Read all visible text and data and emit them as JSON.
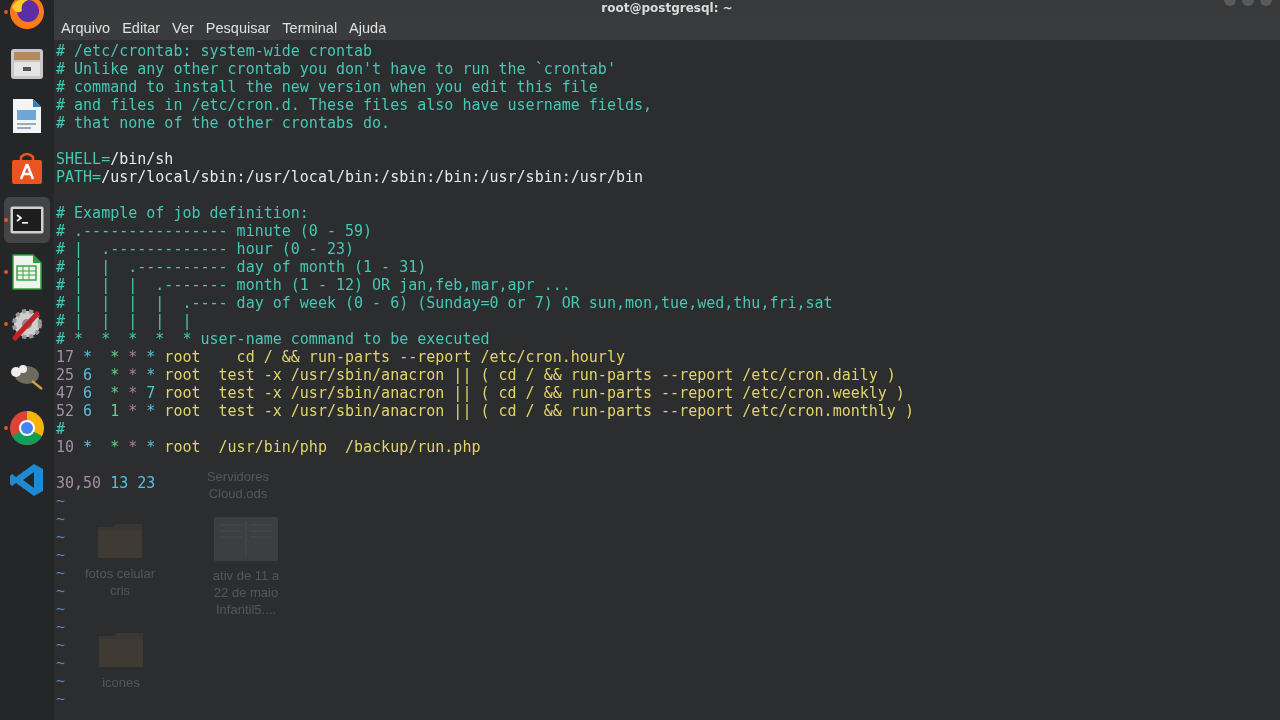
{
  "dock": {
    "items": [
      {
        "kind": "fox",
        "running": true,
        "selected": false
      },
      {
        "kind": "cabinet",
        "running": false,
        "selected": false
      },
      {
        "kind": "document",
        "running": false,
        "selected": false
      },
      {
        "kind": "bag",
        "running": false,
        "selected": false
      },
      {
        "kind": "terminal",
        "running": true,
        "selected": true
      },
      {
        "kind": "sheet",
        "running": true,
        "selected": false
      },
      {
        "kind": "wrench",
        "running": true,
        "selected": false
      },
      {
        "kind": "creature",
        "running": false,
        "selected": false
      },
      {
        "kind": "wheel",
        "running": true,
        "selected": false
      },
      {
        "kind": "ribbon",
        "running": false,
        "selected": false
      }
    ]
  },
  "window": {
    "title": "root@postgresql: ~"
  },
  "menu": [
    "Arquivo",
    "Editar",
    "Ver",
    "Pesquisar",
    "Terminal",
    "Ajuda"
  ],
  "desktop_icons": [
    {
      "label": "Servidores Cloud.ods"
    },
    {
      "label": "fotos celular cris",
      "kind": "folder"
    },
    {
      "label": "ativ de 11 a 22 de maio Infantil5....",
      "kind": "document"
    },
    {
      "label": "icones",
      "kind": "folder"
    }
  ],
  "terminal": {
    "lines": [
      {
        "kind": "code",
        "segments": [
          {
            "kind": "comment",
            "text": "# /etc/crontab: system-wide crontab"
          }
        ]
      },
      {
        "kind": "code",
        "segments": [
          {
            "kind": "comment",
            "text": "# Unlike any other crontab you don't have to run the `crontab'"
          }
        ]
      },
      {
        "kind": "code",
        "segments": [
          {
            "kind": "comment",
            "text": "# command to install the new version when you edit this file"
          }
        ]
      },
      {
        "kind": "code",
        "segments": [
          {
            "kind": "comment",
            "text": "# and files in /etc/cron.d. These files also have username fields,"
          }
        ]
      },
      {
        "kind": "code",
        "segments": [
          {
            "kind": "comment",
            "text": "# that none of the other crontabs do."
          }
        ]
      },
      {
        "kind": "blank"
      },
      {
        "kind": "code",
        "segments": [
          {
            "kind": "variable",
            "text": "SHELL="
          },
          {
            "kind": "value",
            "text": "/bin/sh"
          }
        ]
      },
      {
        "kind": "code",
        "segments": [
          {
            "kind": "variable",
            "text": "PATH="
          },
          {
            "kind": "value",
            "text": "/usr/local/sbin:/usr/local/bin:/sbin:/bin:/usr/sbin:/usr/bin"
          }
        ]
      },
      {
        "kind": "blank"
      },
      {
        "kind": "code",
        "segments": [
          {
            "kind": "comment",
            "text": "# Example of job definition:"
          }
        ]
      },
      {
        "kind": "code",
        "segments": [
          {
            "kind": "comment",
            "text": "# .---------------- minute (0 - 59)"
          }
        ]
      },
      {
        "kind": "code",
        "segments": [
          {
            "kind": "comment",
            "text": "# |  .------------- hour (0 - 23)"
          }
        ]
      },
      {
        "kind": "code",
        "segments": [
          {
            "kind": "comment",
            "text": "# |  |  .---------- day of month (1 - 31)"
          }
        ]
      },
      {
        "kind": "code",
        "segments": [
          {
            "kind": "comment",
            "text": "# |  |  |  .------- month (1 - 12) OR jan,feb,mar,apr ..."
          }
        ]
      },
      {
        "kind": "code",
        "segments": [
          {
            "kind": "comment",
            "text": "# |  |  |  |  .---- day of week (0 - 6) (Sunday=0 or 7) OR sun,mon,tue,wed,thu,fri,sat"
          }
        ]
      },
      {
        "kind": "code",
        "segments": [
          {
            "kind": "comment",
            "text": "# |  |  |  |  |"
          }
        ]
      },
      {
        "kind": "code",
        "segments": [
          {
            "kind": "comment",
            "text": "# *  *  *  *  * user-name command to be executed"
          }
        ]
      },
      {
        "kind": "code",
        "segments": [
          {
            "kind": "minute",
            "text": "17"
          },
          {
            "kind": "hour",
            "text": " *"
          },
          {
            "kind": "day",
            "text": "  *"
          },
          {
            "kind": "month",
            "text": " *"
          },
          {
            "kind": "weekday",
            "text": " *"
          },
          {
            "kind": "command",
            "text": " root    cd / && run-parts --report /etc/cron.hourly"
          }
        ]
      },
      {
        "kind": "code",
        "segments": [
          {
            "kind": "minute",
            "text": "25"
          },
          {
            "kind": "hour",
            "text": " 6"
          },
          {
            "kind": "day",
            "text": "  *"
          },
          {
            "kind": "month",
            "text": " *"
          },
          {
            "kind": "weekday",
            "text": " *"
          },
          {
            "kind": "command",
            "text": " root  test -x /usr/sbin/anacron || ( cd / && run-parts --report /etc/cron.daily )"
          }
        ]
      },
      {
        "kind": "code",
        "segments": [
          {
            "kind": "minute",
            "text": "47"
          },
          {
            "kind": "hour",
            "text": " 6"
          },
          {
            "kind": "day",
            "text": "  *"
          },
          {
            "kind": "month",
            "text": " *"
          },
          {
            "kind": "weekday",
            "text": " 7"
          },
          {
            "kind": "command",
            "text": " root  test -x /usr/sbin/anacron || ( cd / && run-parts --report /etc/cron.weekly )"
          }
        ]
      },
      {
        "kind": "code",
        "segments": [
          {
            "kind": "minute",
            "text": "52"
          },
          {
            "kind": "hour",
            "text": " 6"
          },
          {
            "kind": "day",
            "text": "  1"
          },
          {
            "kind": "month",
            "text": " *"
          },
          {
            "kind": "weekday",
            "text": " *"
          },
          {
            "kind": "command",
            "text": " root  test -x /usr/sbin/anacron || ( cd / && run-parts --report /etc/cron.monthly )"
          }
        ]
      },
      {
        "kind": "code",
        "segments": [
          {
            "kind": "comment",
            "text": "#"
          }
        ]
      },
      {
        "kind": "code",
        "segments": [
          {
            "kind": "minute",
            "text": "10"
          },
          {
            "kind": "hour",
            "text": " *"
          },
          {
            "kind": "day",
            "text": "  *"
          },
          {
            "kind": "month",
            "text": " *"
          },
          {
            "kind": "weekday",
            "text": " *"
          },
          {
            "kind": "command",
            "text": " root  /usr/bin/php  /backup/run.php"
          }
        ]
      },
      {
        "kind": "blank"
      },
      {
        "kind": "code",
        "segments": [
          {
            "kind": "minute",
            "text": "30,50"
          },
          {
            "kind": "hour",
            "text": " 13"
          },
          {
            "kind": "weekday",
            "text": " 23"
          }
        ]
      },
      {
        "kind": "marker",
        "text": "~"
      },
      {
        "kind": "marker",
        "text": "~"
      },
      {
        "kind": "marker",
        "text": "~"
      },
      {
        "kind": "marker",
        "text": "~"
      },
      {
        "kind": "marker",
        "text": "~"
      },
      {
        "kind": "marker",
        "text": "~"
      },
      {
        "kind": "marker",
        "text": "~"
      },
      {
        "kind": "marker",
        "text": "~"
      },
      {
        "kind": "marker",
        "text": "~"
      },
      {
        "kind": "marker",
        "text": "~"
      },
      {
        "kind": "marker",
        "text": "~"
      },
      {
        "kind": "marker",
        "text": "~"
      }
    ]
  }
}
